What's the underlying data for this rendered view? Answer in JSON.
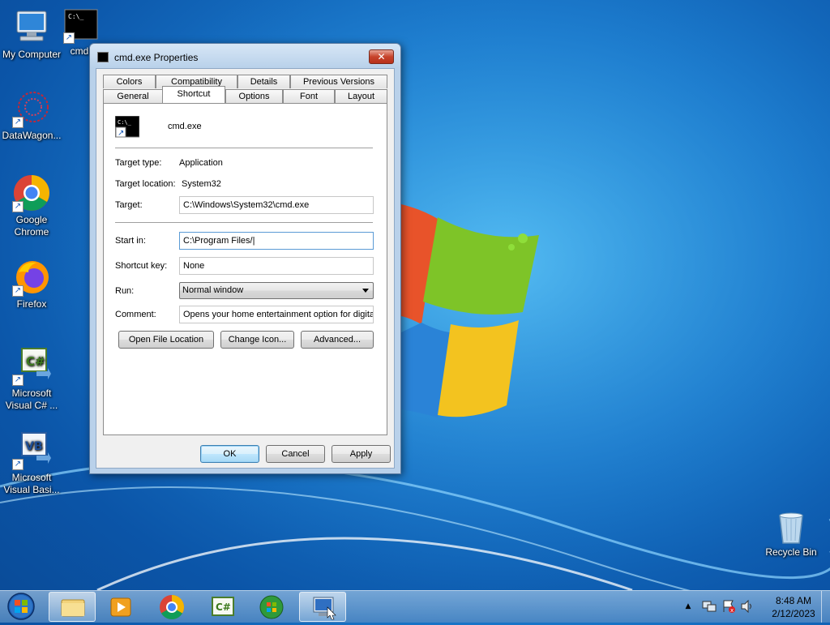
{
  "desktop": {
    "icons": [
      {
        "label": "My Computer"
      },
      {
        "label": "cmd"
      },
      {
        "label": "DataWagon..."
      },
      {
        "label": "Google Chrome"
      },
      {
        "label": "Firefox"
      },
      {
        "label": "Microsoft Visual C# ..."
      },
      {
        "label": "Microsoft Visual Basi..."
      },
      {
        "label": "Recycle Bin"
      }
    ]
  },
  "dialog": {
    "title": "cmd.exe Properties",
    "close_label": "✕",
    "tabs_row1": [
      "Colors",
      "Compatibility",
      "Details",
      "Previous Versions"
    ],
    "tabs_row2": [
      "General",
      "Shortcut",
      "Options",
      "Font",
      "Layout"
    ],
    "active_tab": "Shortcut",
    "file_name": "cmd.exe",
    "target_type_label": "Target type:",
    "target_type_value": "Application",
    "target_location_label": "Target location:",
    "target_location_value": "System32",
    "target_label": "Target:",
    "target_value": "C:\\Windows\\System32\\cmd.exe",
    "start_in_label": "Start in:",
    "start_in_value": "C:\\Program Files/|",
    "shortcut_key_label": "Shortcut key:",
    "shortcut_key_value": "None",
    "run_label": "Run:",
    "run_value": "Normal window",
    "comment_label": "Comment:",
    "comment_value": "Opens your home entertainment option for digita",
    "open_file_location_label": "Open File Location",
    "change_icon_label": "Change Icon...",
    "advanced_label": "Advanced...",
    "ok_label": "OK",
    "cancel_label": "Cancel",
    "apply_label": "Apply"
  },
  "taskbar": {
    "pinned": [
      "start-button",
      "windows-explorer",
      "media-player",
      "google-chrome",
      "visual-csharp",
      "windows-media-center",
      "remote-desktop"
    ],
    "time": "8:48 AM",
    "date": "2/12/2023"
  }
}
